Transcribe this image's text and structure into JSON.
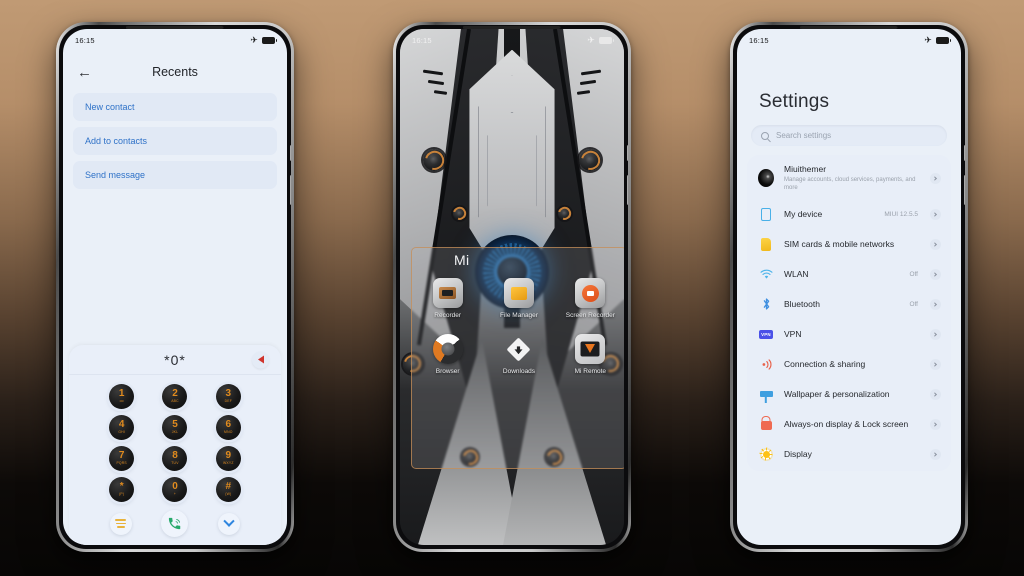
{
  "background": {
    "top_color": "#c09a74",
    "bottom_color": "#070605"
  },
  "phones": {
    "left": {
      "status": {
        "time": "16:15",
        "airplane_icon": "airplane-icon",
        "battery_icon": "battery-icon"
      },
      "header": {
        "back_icon": "back-arrow-icon",
        "title": "Recents"
      },
      "actions": [
        {
          "label": "New contact"
        },
        {
          "label": "Add to contacts"
        },
        {
          "label": "Send message"
        }
      ],
      "dialer": {
        "number": "*0*",
        "backspace_icon": "backspace-icon",
        "keys": [
          {
            "digit": "1",
            "letters": "oo"
          },
          {
            "digit": "2",
            "letters": "ABC"
          },
          {
            "digit": "3",
            "letters": "DEF"
          },
          {
            "digit": "4",
            "letters": "GHI"
          },
          {
            "digit": "5",
            "letters": "JKL"
          },
          {
            "digit": "6",
            "letters": "MNO"
          },
          {
            "digit": "7",
            "letters": "PQRS"
          },
          {
            "digit": "8",
            "letters": "TUV"
          },
          {
            "digit": "9",
            "letters": "WXYZ"
          },
          {
            "digit": "*",
            "letters": "(P)"
          },
          {
            "digit": "0",
            "letters": "+"
          },
          {
            "digit": "#",
            "letters": "(W)"
          }
        ],
        "bottom": {
          "menu_icon": "menu-icon",
          "call_icon": "call-icon",
          "collapse_icon": "chevron-down-icon"
        }
      },
      "accent_key_color": "#e08b1e",
      "action_text_color": "#2f72c8"
    },
    "middle": {
      "status": {
        "time": "16:15",
        "airplane_icon": "airplane-icon",
        "battery_icon": "battery-icon"
      },
      "folder": {
        "title": "Mi",
        "apps": [
          {
            "label": "Recorder",
            "icon": "recorder-icon"
          },
          {
            "label": "File Manager",
            "icon": "file-manager-icon"
          },
          {
            "label": "Screen Recorder",
            "icon": "screen-recorder-icon"
          },
          {
            "label": "Browser",
            "icon": "browser-icon"
          },
          {
            "label": "Downloads",
            "icon": "downloads-icon"
          },
          {
            "label": "Mi Remote",
            "icon": "mi-remote-icon"
          }
        ],
        "border_color": "#c48c56"
      },
      "wallpaper": {
        "style": "mecha-armor",
        "core_color": "#2f7fc0",
        "bolt_color": "#c8823a"
      }
    },
    "right": {
      "status": {
        "time": "16:15",
        "airplane_icon": "airplane-icon",
        "battery_icon": "battery-icon"
      },
      "title": "Settings",
      "search": {
        "placeholder": "Search settings",
        "icon": "search-icon"
      },
      "items": [
        {
          "label": "Miuithemer",
          "sub": "Manage accounts, cloud services, payments, and more",
          "value": "",
          "icon": "avatar"
        },
        {
          "label": "My device",
          "sub": "",
          "value": "MIUI 12.5.5",
          "icon": "device-icon"
        },
        {
          "label": "SIM cards & mobile networks",
          "sub": "",
          "value": "",
          "icon": "sim-card-icon"
        },
        {
          "label": "WLAN",
          "sub": "",
          "value": "Off",
          "icon": "wifi-icon"
        },
        {
          "label": "Bluetooth",
          "sub": "",
          "value": "Off",
          "icon": "bluetooth-icon"
        },
        {
          "label": "VPN",
          "sub": "",
          "value": "",
          "icon": "vpn-icon"
        },
        {
          "label": "Connection & sharing",
          "sub": "",
          "value": "",
          "icon": "connection-sharing-icon"
        },
        {
          "label": "Wallpaper & personalization",
          "sub": "",
          "value": "",
          "icon": "wallpaper-icon"
        },
        {
          "label": "Always-on display & Lock screen",
          "sub": "",
          "value": "",
          "icon": "lock-icon"
        },
        {
          "label": "Display",
          "sub": "",
          "value": "",
          "icon": "brightness-icon"
        }
      ]
    }
  }
}
